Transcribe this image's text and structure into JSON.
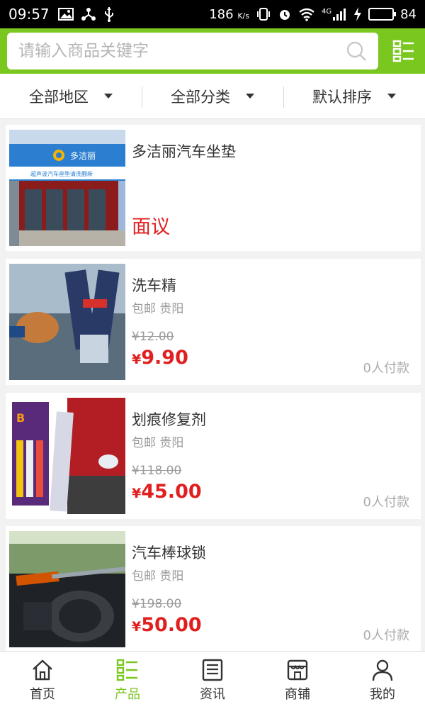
{
  "status_bar": {
    "time": "09:57",
    "speed": "186",
    "speed_unit": "K/s",
    "network": "4G",
    "battery": "84",
    "battery_level": 0.84
  },
  "search": {
    "placeholder": "请输入商品关键字",
    "icon": "search-icon",
    "menu_icon": "grid-list-icon"
  },
  "filters": [
    {
      "label": "全部地区"
    },
    {
      "label": "全部分类"
    },
    {
      "label": "默认排序"
    }
  ],
  "products": [
    {
      "name": "多洁丽汽车坐垫",
      "price_text": "面议",
      "store_sign": "多洁丽",
      "store_subtitle": "超声波汽车座垫清洗翻新"
    },
    {
      "name": "洗车精",
      "shipping": "包邮 贵阳",
      "old_price": "¥12.00",
      "currency": "¥",
      "price": "9.90",
      "paid": "0人付款"
    },
    {
      "name": "划痕修复剂",
      "shipping": "包邮 贵阳",
      "old_price": "¥118.00",
      "currency": "¥",
      "price": "45.00",
      "paid": "0人付款"
    },
    {
      "name": "汽车棒球锁",
      "shipping": "包邮 贵阳",
      "old_price": "¥198.00",
      "currency": "¥",
      "price": "50.00",
      "paid": "0人付款"
    }
  ],
  "bottom_nav": [
    {
      "label": "首页",
      "icon": "home-icon"
    },
    {
      "label": "产品",
      "icon": "product-list-icon",
      "active": true
    },
    {
      "label": "资讯",
      "icon": "news-icon"
    },
    {
      "label": "商铺",
      "icon": "store-icon"
    },
    {
      "label": "我的",
      "icon": "user-icon"
    }
  ],
  "colors": {
    "accent": "#7ac71f",
    "price": "#e02020"
  }
}
